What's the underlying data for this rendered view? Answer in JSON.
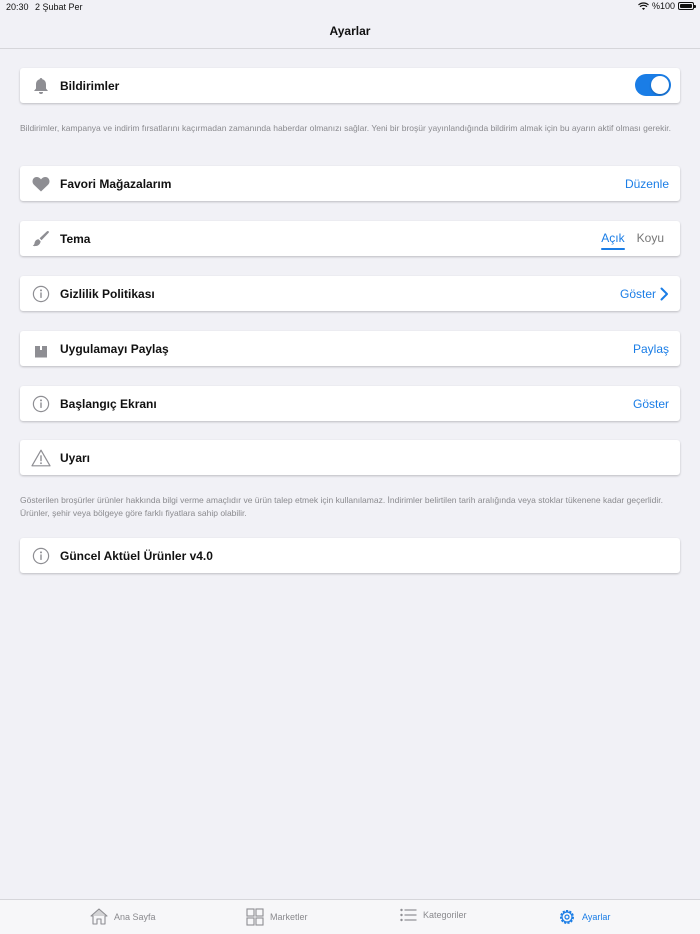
{
  "status": {
    "time": "20:30",
    "date": "2 Şubat Per",
    "battery": "%100"
  },
  "nav": {
    "title": "Ayarlar"
  },
  "settings": {
    "notifications": {
      "label": "Bildirimler",
      "enabled": true
    },
    "notifications_note": "Bildirimler, kampanya ve indirim fırsatlarını kaçırmadan zamanında haberdar olmanızı sağlar. Yeni bir broşür yayınlandığında bildirim almak için bu ayarın aktif olması gerekir.",
    "favorites": {
      "label": "Favori Mağazalarım",
      "action": "Düzenle"
    },
    "theme": {
      "label": "Tema",
      "options": [
        "Açık",
        "Koyu"
      ],
      "selected": "Açık"
    },
    "privacy": {
      "label": "Gizlilik Politikası",
      "action": "Göster"
    },
    "share": {
      "label": "Uygulamayı Paylaş",
      "action": "Paylaş"
    },
    "startup": {
      "label": "Başlangıç Ekranı",
      "action": "Göster"
    },
    "warning": {
      "label": "Uyarı"
    },
    "warning_note": "Gösterilen broşürler ürünler hakkında bilgi verme amaçlıdır ve ürün talep etmek için kullanılamaz. İndirimler belirtilen tarih aralığında veya stoklar tükenene kadar geçerlidir. Ürünler, şehir veya bölgeye göre farklı fiyatlara sahip olabilir.",
    "version": {
      "label": "Güncel Aktüel Ürünler v4.0"
    }
  },
  "tabs": [
    {
      "label": "Ana Sayfa",
      "icon": "home-icon",
      "active": false
    },
    {
      "label": "Marketler",
      "icon": "grid-icon",
      "active": false
    },
    {
      "label": "Kategoriler",
      "icon": "list-icon",
      "active": false
    },
    {
      "label": "Ayarlar",
      "icon": "gear-icon",
      "active": true
    }
  ],
  "colors": {
    "accent": "#1a7de6",
    "background": "#f1f1f6",
    "icon_gray": "#8e8e93"
  }
}
